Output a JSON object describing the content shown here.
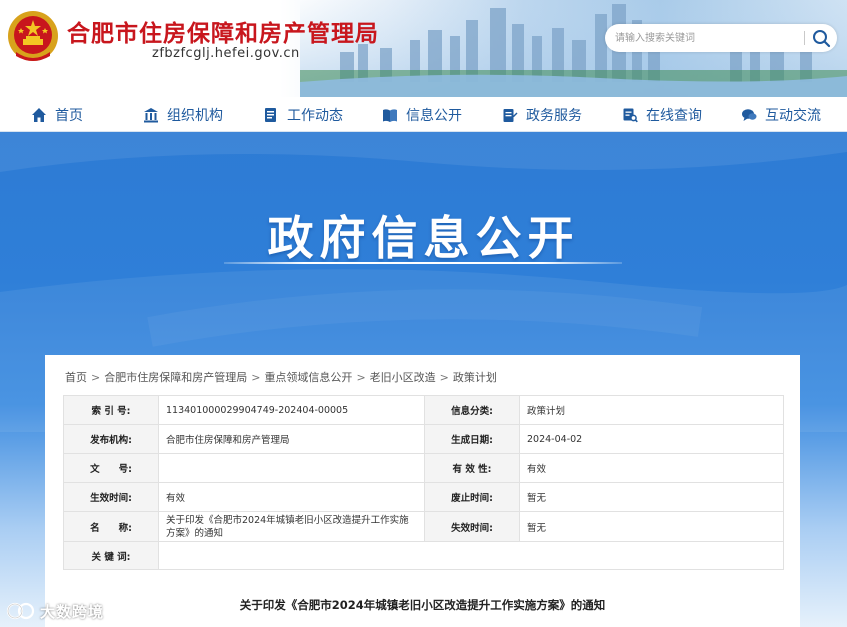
{
  "header": {
    "site_title": "合肥市住房保障和房产管理局",
    "site_domain": "zfbzfcglj.hefei.gov.cn",
    "search": {
      "placeholder": "请输入搜索关键词"
    }
  },
  "nav": {
    "items": [
      {
        "label": "首页",
        "icon": "home-icon"
      },
      {
        "label": "组织机构",
        "icon": "building-icon"
      },
      {
        "label": "工作动态",
        "icon": "document-icon"
      },
      {
        "label": "信息公开",
        "icon": "book-icon"
      },
      {
        "label": "政务服务",
        "icon": "edit-icon"
      },
      {
        "label": "在线查询",
        "icon": "query-icon"
      },
      {
        "label": "互动交流",
        "icon": "chat-icon"
      }
    ],
    "color": "#1f5a9e"
  },
  "banner": {
    "title": "政府信息公开"
  },
  "breadcrumb": {
    "items": [
      "首页",
      "合肥市住房保障和房产管理局",
      "重点领域信息公开",
      "老旧小区改造",
      "政策计划"
    ],
    "separator": ">"
  },
  "meta": {
    "index_label": "索 引 号:",
    "index_value": "113401000029904749-202404-00005",
    "category_label": "信息分类:",
    "category_value": "政策计划",
    "publisher_label": "发布机构:",
    "publisher_value": "合肥市住房保障和房产管理局",
    "created_label": "生成日期:",
    "created_value": "2024-04-02",
    "docno_label": "文　　号:",
    "docno_value": "",
    "validity_label": "有 效 性:",
    "validity_value": "有效",
    "effective_label": "生效时间:",
    "effective_value": "有效",
    "repeal_label": "废止时间:",
    "repeal_value": "暂无",
    "name_label": "名　　称:",
    "name_value": "关于印发《合肥市2024年城镇老旧小区改造提升工作实施方案》的通知",
    "invalid_label": "失效时间:",
    "invalid_value": "暂无",
    "keywords_label": "关 键 词:",
    "keywords_value": ""
  },
  "document": {
    "title": "关于印发《合肥市2024年城镇老旧小区改造提升工作实施方案》的通知"
  },
  "watermark": {
    "text": "大数跨境"
  },
  "colors": {
    "brand_red": "#c8161d",
    "banner_blue": "#2f7fd8"
  }
}
